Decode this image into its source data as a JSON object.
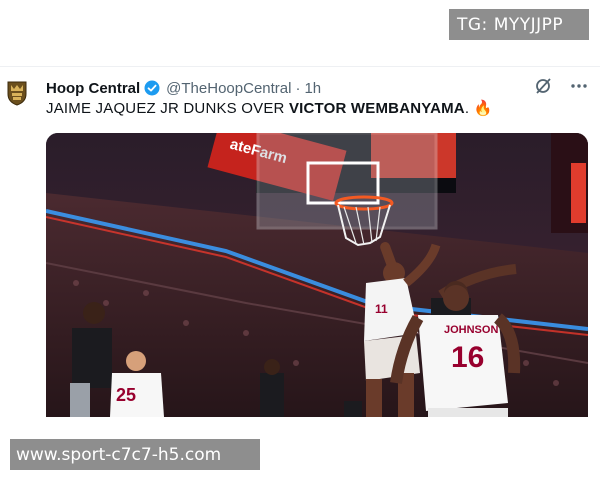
{
  "watermarks": {
    "top": "TG: MYYJJPP",
    "bottom": "www.sport-c7c7-h5.com"
  },
  "tweet": {
    "display_name": "Hoop Central",
    "handle": "@TheHoopCentral",
    "separator": "·",
    "time": "1h",
    "text_plain": "JAIME JAQUEZ JR DUNKS OVER ",
    "text_bold": "VICTOR WEMBANYAMA",
    "text_end": ". 🔥",
    "verified_color": "#1d9bf0",
    "icons": [
      "avatar-logo",
      "verified-badge-icon",
      "grok-icon",
      "more-icon"
    ]
  },
  "media": {
    "description_kind": "basketball-dunk-photo",
    "jersey_left_number": "11",
    "jersey_right_name": "JOHNSON",
    "jersey_right_number": "16",
    "jersey_bottom_left_number": "25",
    "sign_text": "ateFarm",
    "colors": {
      "heat_red": "#98002e",
      "court_glow": "#ff3a2c",
      "spurs_black": "#1b1b1f"
    }
  }
}
